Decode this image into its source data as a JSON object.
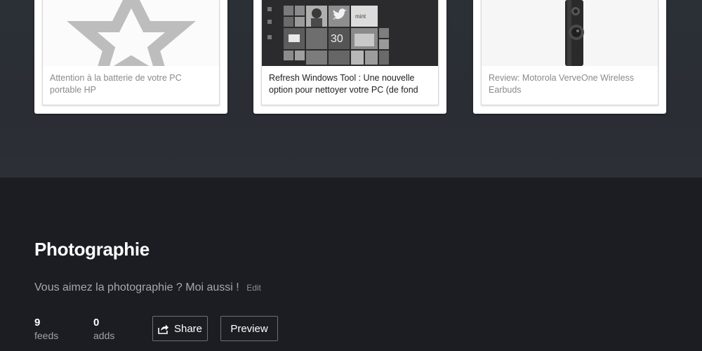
{
  "cards": [
    {
      "caption": "Attention à la batterie de votre PC portable HP",
      "thumb_icon": "star-icon"
    },
    {
      "caption": "Refresh Windows Tool : Une nouvelle option pour nettoyer votre PC (de fond",
      "thumb_icon": "windows-tiles-image",
      "tile_texts": {
        "date": "30",
        "brand": "mint"
      }
    },
    {
      "caption": "Review: Motorola VerveOne Wireless Earbuds",
      "thumb_icon": "earbuds-image"
    }
  ],
  "collection": {
    "title": "Photographie",
    "description": "Vous aimez la photographie ? Moi aussi !",
    "edit_label": "Edit"
  },
  "stats": {
    "feeds_count": "9",
    "feeds_label": "feeds",
    "adds_count": "0",
    "adds_label": "adds"
  },
  "actions": {
    "share_label": "Share",
    "preview_label": "Preview"
  },
  "colors": {
    "top_background": "#2b2f36",
    "bottom_background": "#1b1d22",
    "card_background": "#ffffff"
  }
}
